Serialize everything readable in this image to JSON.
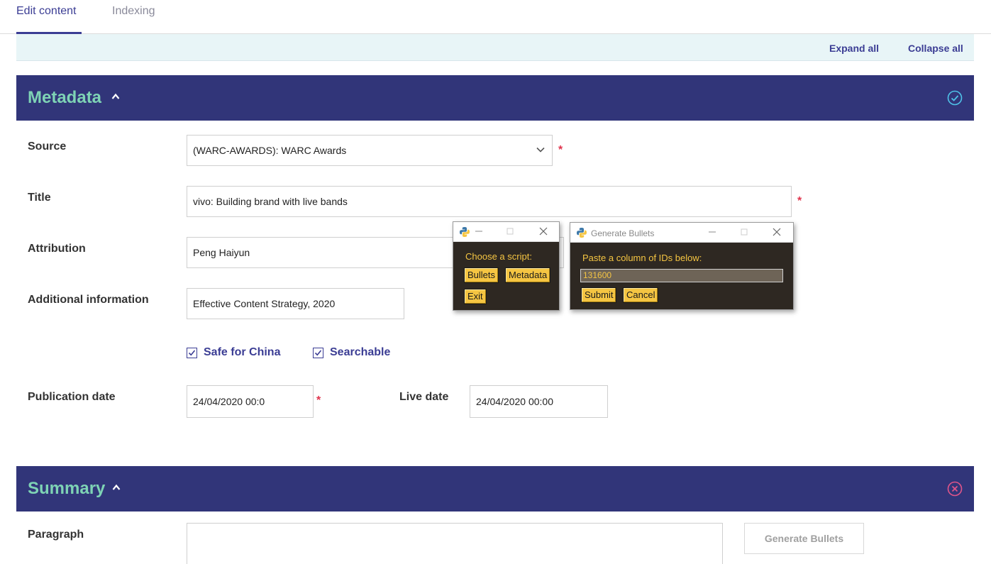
{
  "tabs": [
    {
      "label": "Edit content"
    },
    {
      "label": "Indexing"
    }
  ],
  "toolbar": {
    "expand_all": "Expand all",
    "collapse_all": "Collapse all"
  },
  "metadata": {
    "title": "Metadata",
    "status_icon": "check-circle-icon",
    "source": {
      "label": "Source",
      "value": "(WARC-AWARDS): WARC Awards",
      "required": "*"
    },
    "title_field": {
      "label": "Title",
      "value": "vivo: Building brand with live bands",
      "required": "*"
    },
    "attribution": {
      "label": "Attribution",
      "value": "Peng Haiyun"
    },
    "additional": {
      "label": "Additional information",
      "value": "Effective Content Strategy, 2020"
    },
    "checkboxes": {
      "safe_for_china": "Safe for China",
      "searchable": "Searchable"
    },
    "publication_date": {
      "label": "Publication date",
      "value": "24/04/2020 00:0",
      "required": "*"
    },
    "live_date": {
      "label": "Live date",
      "value": "24/04/2020 00:00"
    }
  },
  "summary": {
    "title": "Summary",
    "status_icon": "x-circle-icon",
    "paragraph_label": "Paragraph",
    "generate_bullets": "Generate Bullets"
  },
  "script_window": {
    "title": "",
    "prompt": "Choose a script:",
    "buttons": {
      "bullets": "Bullets",
      "metadata": "Metadata",
      "exit": "Exit"
    }
  },
  "bullets_window": {
    "title": "Generate Bullets",
    "prompt": "Paste a column of IDs below:",
    "input_value": "131600",
    "buttons": {
      "submit": "Submit",
      "cancel": "Cancel"
    }
  },
  "colors": {
    "nav_accent": "#3b3d94",
    "section_bg": "#313579",
    "section_title": "#7ed3b5",
    "required": "#e0344d",
    "py_bg": "#2e2822",
    "py_accent": "#f5c542"
  }
}
